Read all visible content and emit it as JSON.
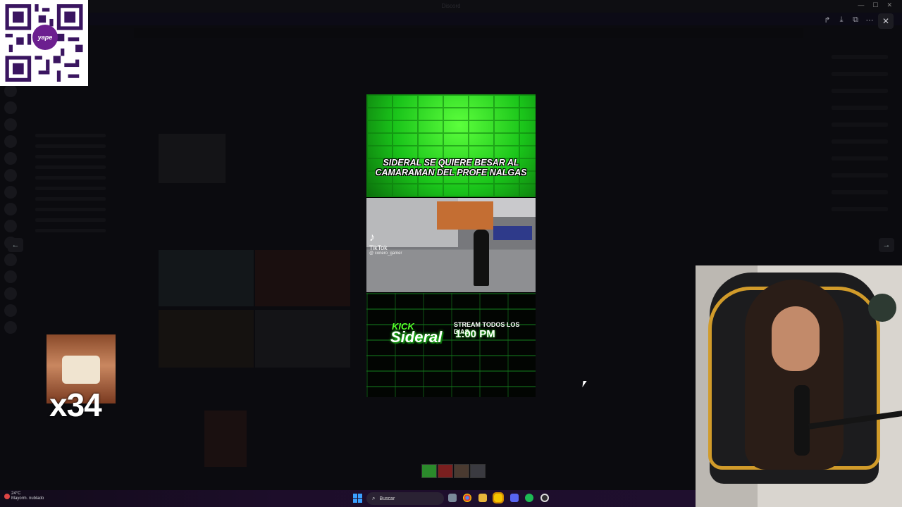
{
  "window": {
    "title": "Discord"
  },
  "viewer": {
    "tools": [
      "forward-icon",
      "download-icon",
      "open-external-icon",
      "more-icon"
    ],
    "close": "✕",
    "prev": "←",
    "next": "→"
  },
  "qr": {
    "logo_text": "yape"
  },
  "emote": {
    "count": "x34"
  },
  "video": {
    "title": "SIDERAL SE QUIERE BESAR AL CAMARAMAN DEL PROFE NALGAS",
    "tiktok_label": "TikTok",
    "tiktok_handle": "@ conero_gamer",
    "kick_label": "KICK",
    "brand": "Sideral",
    "stream_line1": "STREAM TODOS LOS DIAS",
    "stream_line2": "1:00 PM"
  },
  "taskbar": {
    "weather_temp": "24°C",
    "weather_desc": "Mayorm. nublado",
    "search_placeholder": "Buscar",
    "apps": [
      "widgets",
      "chrome",
      "file-explorer",
      "sticky-notes",
      "discord",
      "spotify",
      "obs"
    ]
  },
  "colors": {
    "accent_green": "#2cff22",
    "taskbar": "#1d0d2a",
    "chair_trim": "#d19b2a"
  }
}
